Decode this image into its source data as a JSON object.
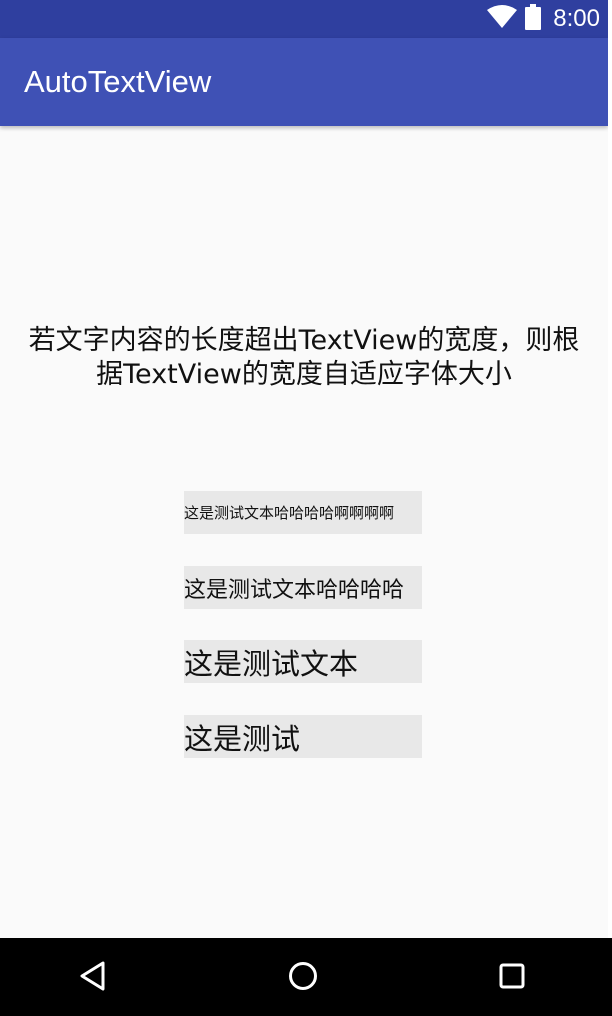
{
  "status_bar": {
    "time": "8:00",
    "icons": [
      "wifi-icon",
      "battery-icon"
    ]
  },
  "app_bar": {
    "title": "AutoTextView"
  },
  "description": {
    "line1": "若文字内容的长度超出TextView的宽度，则根",
    "line2": "据TextView的宽度自适应字体大小"
  },
  "samples": [
    "这是测试文本哈哈哈哈啊啊啊啊",
    "这是测试文本哈哈哈哈",
    "这是测试文本",
    "这是测试"
  ],
  "nav_bar": {
    "buttons": [
      "back-icon",
      "home-icon",
      "recents-icon"
    ]
  },
  "colors": {
    "status_bar": "#2f3f9f",
    "app_bar": "#3f51b5",
    "background": "#fafafa",
    "sample_bg": "#e8e8e8",
    "nav_bar": "#000000"
  }
}
